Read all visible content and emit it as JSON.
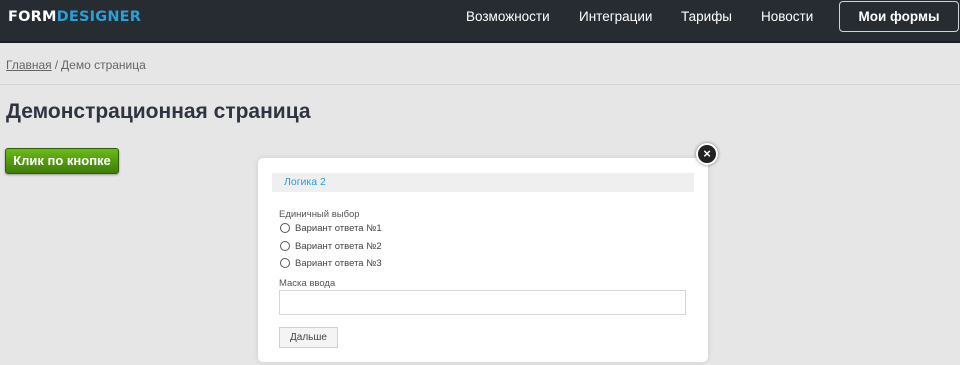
{
  "navbar": {
    "logo_part1": "FORM",
    "logo_part2": "DESIGNER",
    "links": [
      "Возможности",
      "Интеграции",
      "Тарифы",
      "Новости"
    ],
    "cta_label": "Мои формы"
  },
  "breadcrumb": {
    "home": "Главная",
    "separator": "/",
    "current": "Демо страница"
  },
  "page": {
    "title": "Демонстрационная страница",
    "demo_button": "Клик по кнопке"
  },
  "modal": {
    "close_symbol": "×",
    "section_title": "Логика 2",
    "single_choice_label": "Единичный выбор",
    "options": [
      "Вариант ответа №1",
      "Вариант ответа №2",
      "Вариант ответа №3"
    ],
    "mask_label": "Маска ввода",
    "mask_value": "",
    "next_button": "Дальше"
  },
  "colors": {
    "navbar_bg": "#272c33",
    "accent_blue": "#2a9fd8",
    "button_green": "#5aa215",
    "page_bg": "#e6e6e6"
  }
}
